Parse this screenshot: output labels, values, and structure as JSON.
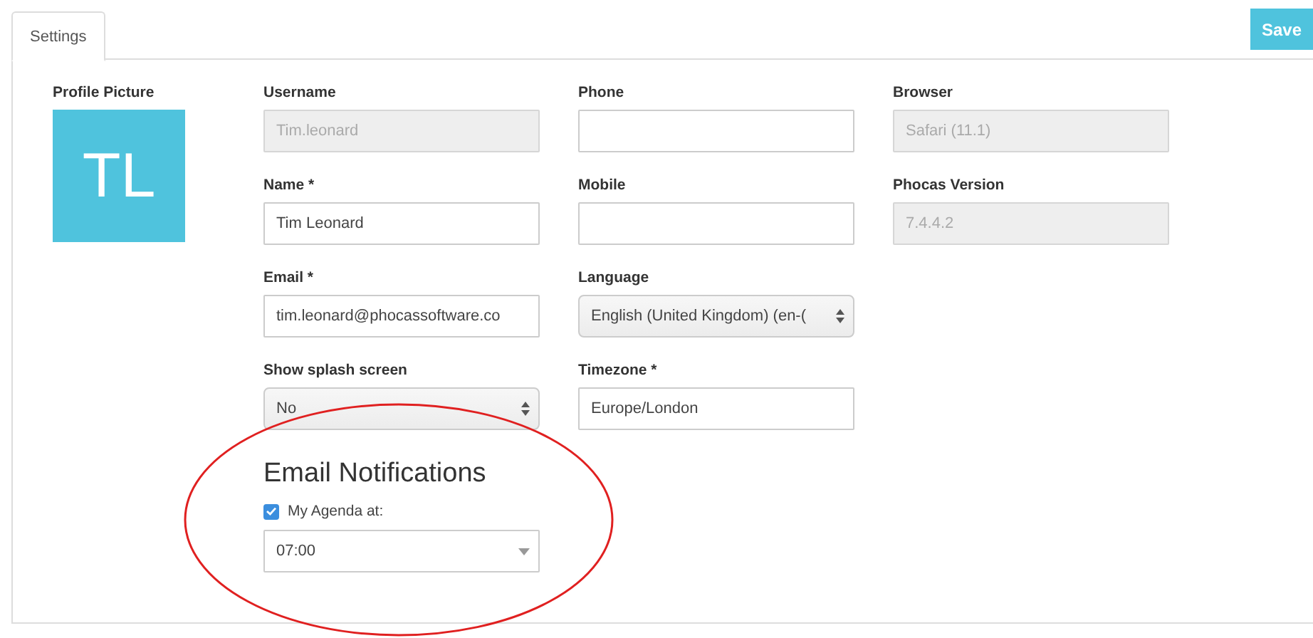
{
  "tabs": [
    {
      "label": "Settings",
      "selected": true
    }
  ],
  "save_button": "Save",
  "profile": {
    "label": "Profile Picture",
    "initials": "TL"
  },
  "columns": [
    [
      {
        "label": "Username",
        "value": "Tim.leonard",
        "kind": "input",
        "disabled": true
      },
      {
        "label": "Name *",
        "value": "Tim Leonard",
        "kind": "input",
        "disabled": false
      },
      {
        "label": "Email *",
        "value": "tim.leonard@phocassoftware.co",
        "kind": "input",
        "disabled": false
      },
      {
        "label": "Show splash screen",
        "value": "No",
        "kind": "select",
        "disabled": false
      }
    ],
    [
      {
        "label": "Phone",
        "kind": "input",
        "disabled": false
      },
      {
        "label": "Mobile",
        "kind": "input",
        "disabled": false
      },
      {
        "label": "Language",
        "value": "English (United Kingdom) (en-(",
        "kind": "select",
        "disabled": false
      },
      {
        "label": "Timezone *",
        "value": "Europe/London",
        "kind": "input",
        "disabled": false
      }
    ],
    [
      {
        "label": "Browser",
        "value": "Safari (11.1)",
        "kind": "input",
        "disabled": true
      },
      {
        "label": "Phocas Version",
        "value": "7.4.4.2",
        "kind": "input",
        "disabled": true
      }
    ]
  ],
  "notifications": {
    "heading": "Email Notifications",
    "checkbox": {
      "label": "My Agenda at:",
      "checked": true
    },
    "time": {
      "value": "07:00",
      "kind": "dropdown"
    }
  },
  "annotation": {
    "kind": "ellipse"
  }
}
